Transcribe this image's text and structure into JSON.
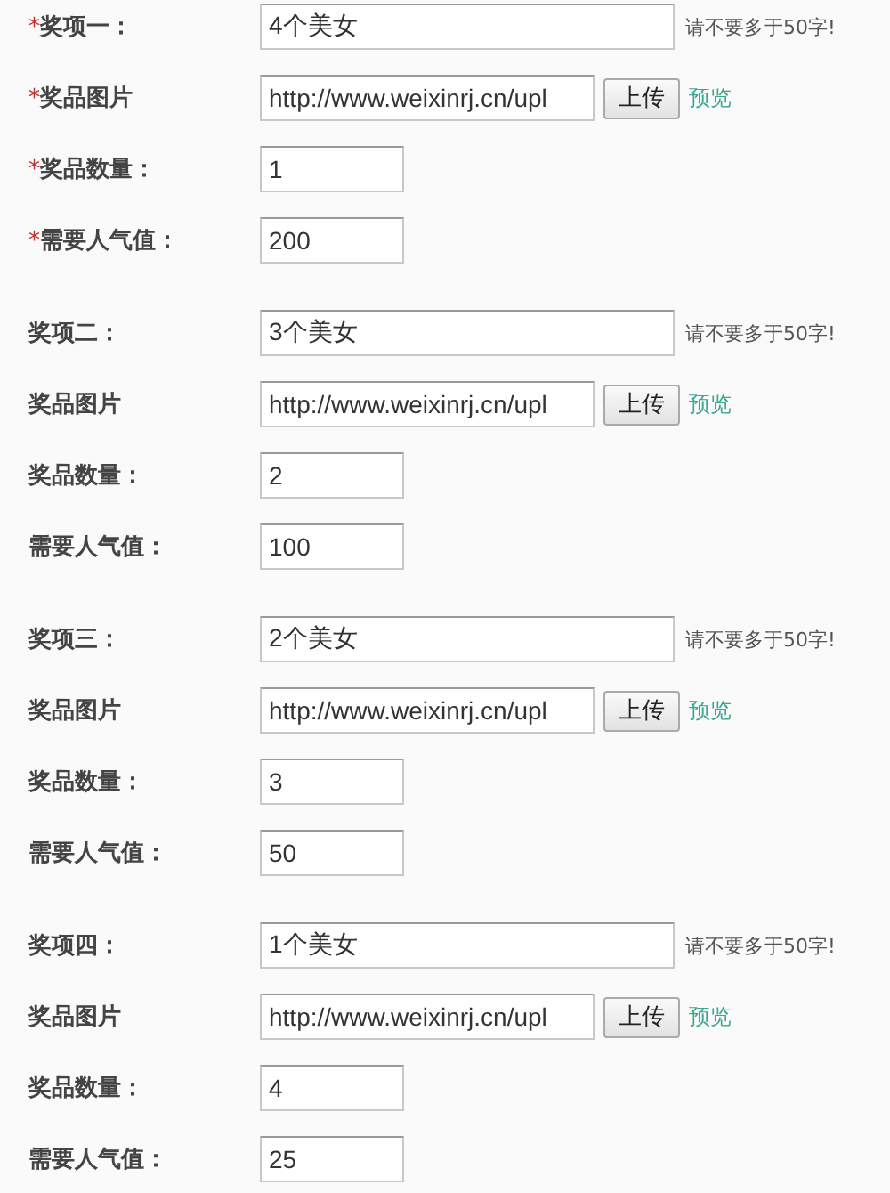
{
  "groups": [
    {
      "required_mark": "*",
      "fields": [
        {
          "kind": "name",
          "label": "奖项一：",
          "value": "4个美女",
          "hint": "请不要多于50字!"
        },
        {
          "kind": "image",
          "label": "奖品图片",
          "value": "http://www.weixinrj.cn/upl",
          "button": "上传",
          "link": "预览"
        },
        {
          "kind": "number",
          "label": "奖品数量：",
          "value": "1"
        },
        {
          "kind": "number",
          "label": "需要人气值：",
          "value": "200"
        }
      ]
    },
    {
      "fields": [
        {
          "kind": "name",
          "label": "奖项二：",
          "value": "3个美女",
          "hint": "请不要多于50字!"
        },
        {
          "kind": "image",
          "label": "奖品图片",
          "value": "http://www.weixinrj.cn/upl",
          "button": "上传",
          "link": "预览"
        },
        {
          "kind": "number",
          "label": "奖品数量：",
          "value": "2"
        },
        {
          "kind": "number",
          "label": "需要人气值：",
          "value": "100"
        }
      ]
    },
    {
      "fields": [
        {
          "kind": "name",
          "label": "奖项三：",
          "value": "2个美女",
          "hint": "请不要多于50字!"
        },
        {
          "kind": "image",
          "label": "奖品图片",
          "value": "http://www.weixinrj.cn/upl",
          "button": "上传",
          "link": "预览"
        },
        {
          "kind": "number",
          "label": "奖品数量：",
          "value": "3"
        },
        {
          "kind": "number",
          "label": "需要人气值：",
          "value": "50"
        }
      ]
    },
    {
      "fields": [
        {
          "kind": "name",
          "label": "奖项四：",
          "value": "1个美女",
          "hint": "请不要多于50字!"
        },
        {
          "kind": "image",
          "label": "奖品图片",
          "value": "http://www.weixinrj.cn/upl",
          "button": "上传",
          "link": "预览"
        },
        {
          "kind": "number",
          "label": "奖品数量：",
          "value": "4"
        },
        {
          "kind": "number",
          "label": "需要人气值：",
          "value": "25"
        }
      ]
    }
  ]
}
